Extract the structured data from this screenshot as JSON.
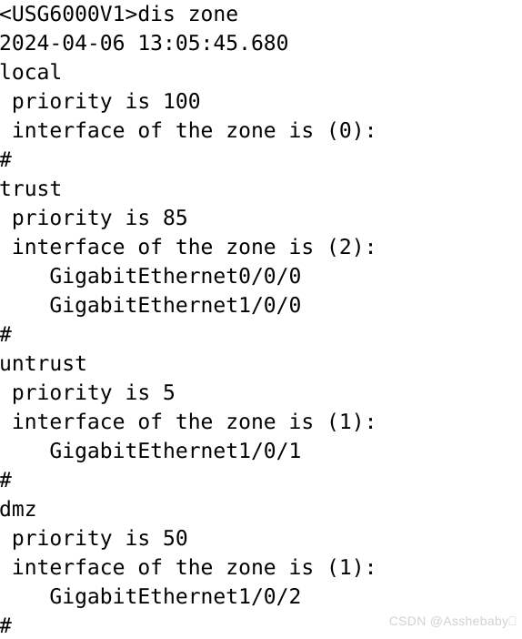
{
  "terminal": {
    "prompt": "<USG6000V1>",
    "command": "dis zone",
    "timestamp": "2024-04-06 13:05:45.680",
    "background_color": "#ffffff",
    "text_color": "#000000",
    "lines": [
      "<USG6000V1>dis zone",
      "2024-04-06 13:05:45.680",
      "local",
      " priority is 100",
      " interface of the zone is (0):",
      "#",
      "trust",
      " priority is 85",
      " interface of the zone is (2):",
      "    GigabitEthernet0/0/0",
      "    GigabitEthernet1/0/0",
      "#",
      "untrust",
      " priority is 5",
      " interface of the zone is (1):",
      "    GigabitEthernet1/0/1",
      "#",
      "dmz",
      " priority is 50",
      " interface of the zone is (1):",
      "    GigabitEthernet1/0/2",
      "#"
    ],
    "zones": [
      {
        "name": "local",
        "priority_label": "priority is",
        "priority": "100",
        "interface_label": "interface of the zone is",
        "interface_count": "(0):",
        "interfaces": [],
        "separator": "#"
      },
      {
        "name": "trust",
        "priority_label": "priority is",
        "priority": "85",
        "interface_label": "interface of the zone is",
        "interface_count": "(2):",
        "interfaces": [
          "GigabitEthernet0/0/0",
          "GigabitEthernet1/0/0"
        ],
        "separator": "#"
      },
      {
        "name": "untrust",
        "priority_label": "priority is",
        "priority": "5",
        "interface_label": "interface of the zone is",
        "interface_count": "(1):",
        "interfaces": [
          "GigabitEthernet1/0/1"
        ],
        "separator": "#"
      },
      {
        "name": "dmz",
        "priority_label": "priority is",
        "priority": "50",
        "interface_label": "interface of the zone is",
        "interface_count": "(1):",
        "interfaces": [
          "GigabitEthernet1/0/2"
        ],
        "separator": "#"
      }
    ]
  },
  "watermark": {
    "text": "CSDN @Asshebaby⎕",
    "color": "#d2d2d2"
  }
}
